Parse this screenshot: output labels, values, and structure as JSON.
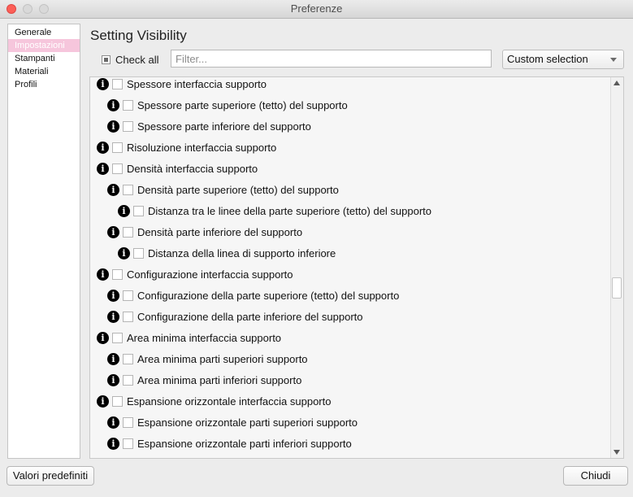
{
  "window": {
    "title": "Preferenze"
  },
  "sidebar": {
    "items": [
      {
        "label": "Generale",
        "active": false
      },
      {
        "label": "Impostazioni",
        "active": true
      },
      {
        "label": "Stampanti",
        "active": false
      },
      {
        "label": "Materiali",
        "active": false
      },
      {
        "label": "Profili",
        "active": false
      }
    ]
  },
  "main": {
    "heading": "Setting Visibility",
    "check_all_label": "Check all",
    "filter_placeholder": "Filter...",
    "filter_value": "",
    "visibility_select": "Custom selection"
  },
  "settings": [
    {
      "label": "Spessore interfaccia supporto",
      "level": 0,
      "checked": false
    },
    {
      "label": "Spessore parte superiore (tetto) del supporto",
      "level": 1,
      "checked": false
    },
    {
      "label": "Spessore parte inferiore del supporto",
      "level": 1,
      "checked": false
    },
    {
      "label": "Risoluzione interfaccia supporto",
      "level": 0,
      "checked": false
    },
    {
      "label": "Densità interfaccia supporto",
      "level": 0,
      "checked": false
    },
    {
      "label": "Densità parte superiore (tetto) del supporto",
      "level": 1,
      "checked": false
    },
    {
      "label": "Distanza tra le linee della parte superiore (tetto) del supporto",
      "level": 2,
      "checked": false
    },
    {
      "label": "Densità parte inferiore del supporto",
      "level": 1,
      "checked": false
    },
    {
      "label": "Distanza della linea di supporto inferiore",
      "level": 2,
      "checked": false
    },
    {
      "label": "Configurazione interfaccia supporto",
      "level": 0,
      "checked": false
    },
    {
      "label": "Configurazione della parte superiore (tetto) del supporto",
      "level": 1,
      "checked": false
    },
    {
      "label": "Configurazione della parte inferiore del supporto",
      "level": 1,
      "checked": false
    },
    {
      "label": "Area minima interfaccia supporto",
      "level": 0,
      "checked": false
    },
    {
      "label": "Area minima parti superiori supporto",
      "level": 1,
      "checked": false
    },
    {
      "label": "Area minima parti inferiori supporto",
      "level": 1,
      "checked": false
    },
    {
      "label": "Espansione orizzontale interfaccia supporto",
      "level": 0,
      "checked": false
    },
    {
      "label": "Espansione orizzontale parti superiori supporto",
      "level": 1,
      "checked": false
    },
    {
      "label": "Espansione orizzontale parti inferiori supporto",
      "level": 1,
      "checked": false
    },
    {
      "label": "",
      "level": 0,
      "checked": false
    }
  ],
  "icons": {
    "info": "i"
  },
  "buttons": {
    "defaults": "Valori predefiniti",
    "close": "Chiudi"
  }
}
